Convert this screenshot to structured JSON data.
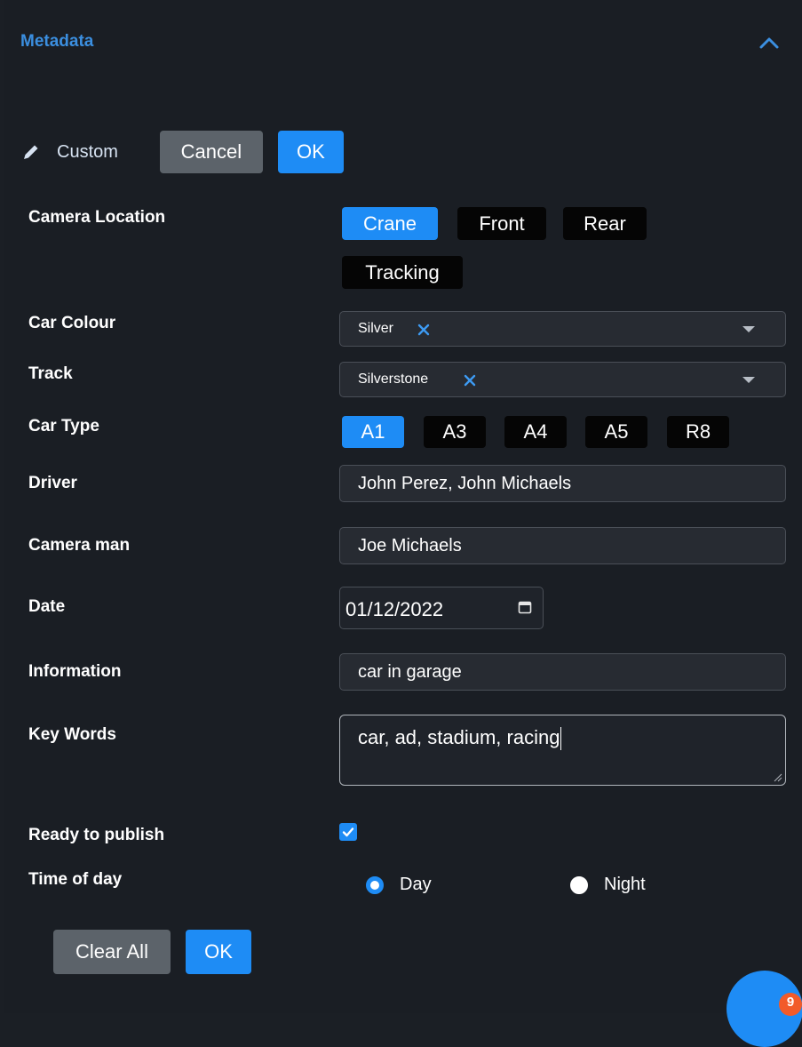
{
  "header": {
    "title": "Metadata"
  },
  "edit_bar": {
    "mode_label": "Custom",
    "cancel_label": "Cancel",
    "ok_label": "OK"
  },
  "fields": {
    "camera_location": {
      "label": "Camera Location",
      "options": [
        "Crane",
        "Front",
        "Rear",
        "Tracking"
      ],
      "selected": "Crane"
    },
    "car_colour": {
      "label": "Car Colour",
      "value": "Silver"
    },
    "track": {
      "label": "Track",
      "value": "Silverstone"
    },
    "car_type": {
      "label": "Car Type",
      "options": [
        "A1",
        "A3",
        "A4",
        "A5",
        "R8"
      ],
      "selected": "A1"
    },
    "driver": {
      "label": "Driver",
      "value": "John Perez, John Michaels"
    },
    "camera_man": {
      "label": "Camera man",
      "value": "Joe Michaels"
    },
    "date": {
      "label": "Date",
      "value": "01/12/2022"
    },
    "information": {
      "label": "Information",
      "value": "car in garage"
    },
    "key_words": {
      "label": "Key Words",
      "value": "car, ad, stadium, racing"
    },
    "ready_to_publish": {
      "label": "Ready to publish",
      "checked": true
    },
    "time_of_day": {
      "label": "Time of day",
      "options": [
        "Day",
        "Night"
      ],
      "selected": "Day"
    }
  },
  "footer": {
    "clear_label": "Clear All",
    "ok_label": "OK"
  },
  "notification": {
    "count": "9"
  },
  "colors": {
    "accent": "#1e8cf5",
    "background": "#1a1e24",
    "chip": "#050505",
    "badge": "#f25b2a"
  },
  "icons": [
    "chevron-up-icon",
    "pencil-icon",
    "close-icon",
    "caret-down-icon",
    "calendar-icon",
    "checkmark-icon",
    "resize-grip-icon"
  ]
}
